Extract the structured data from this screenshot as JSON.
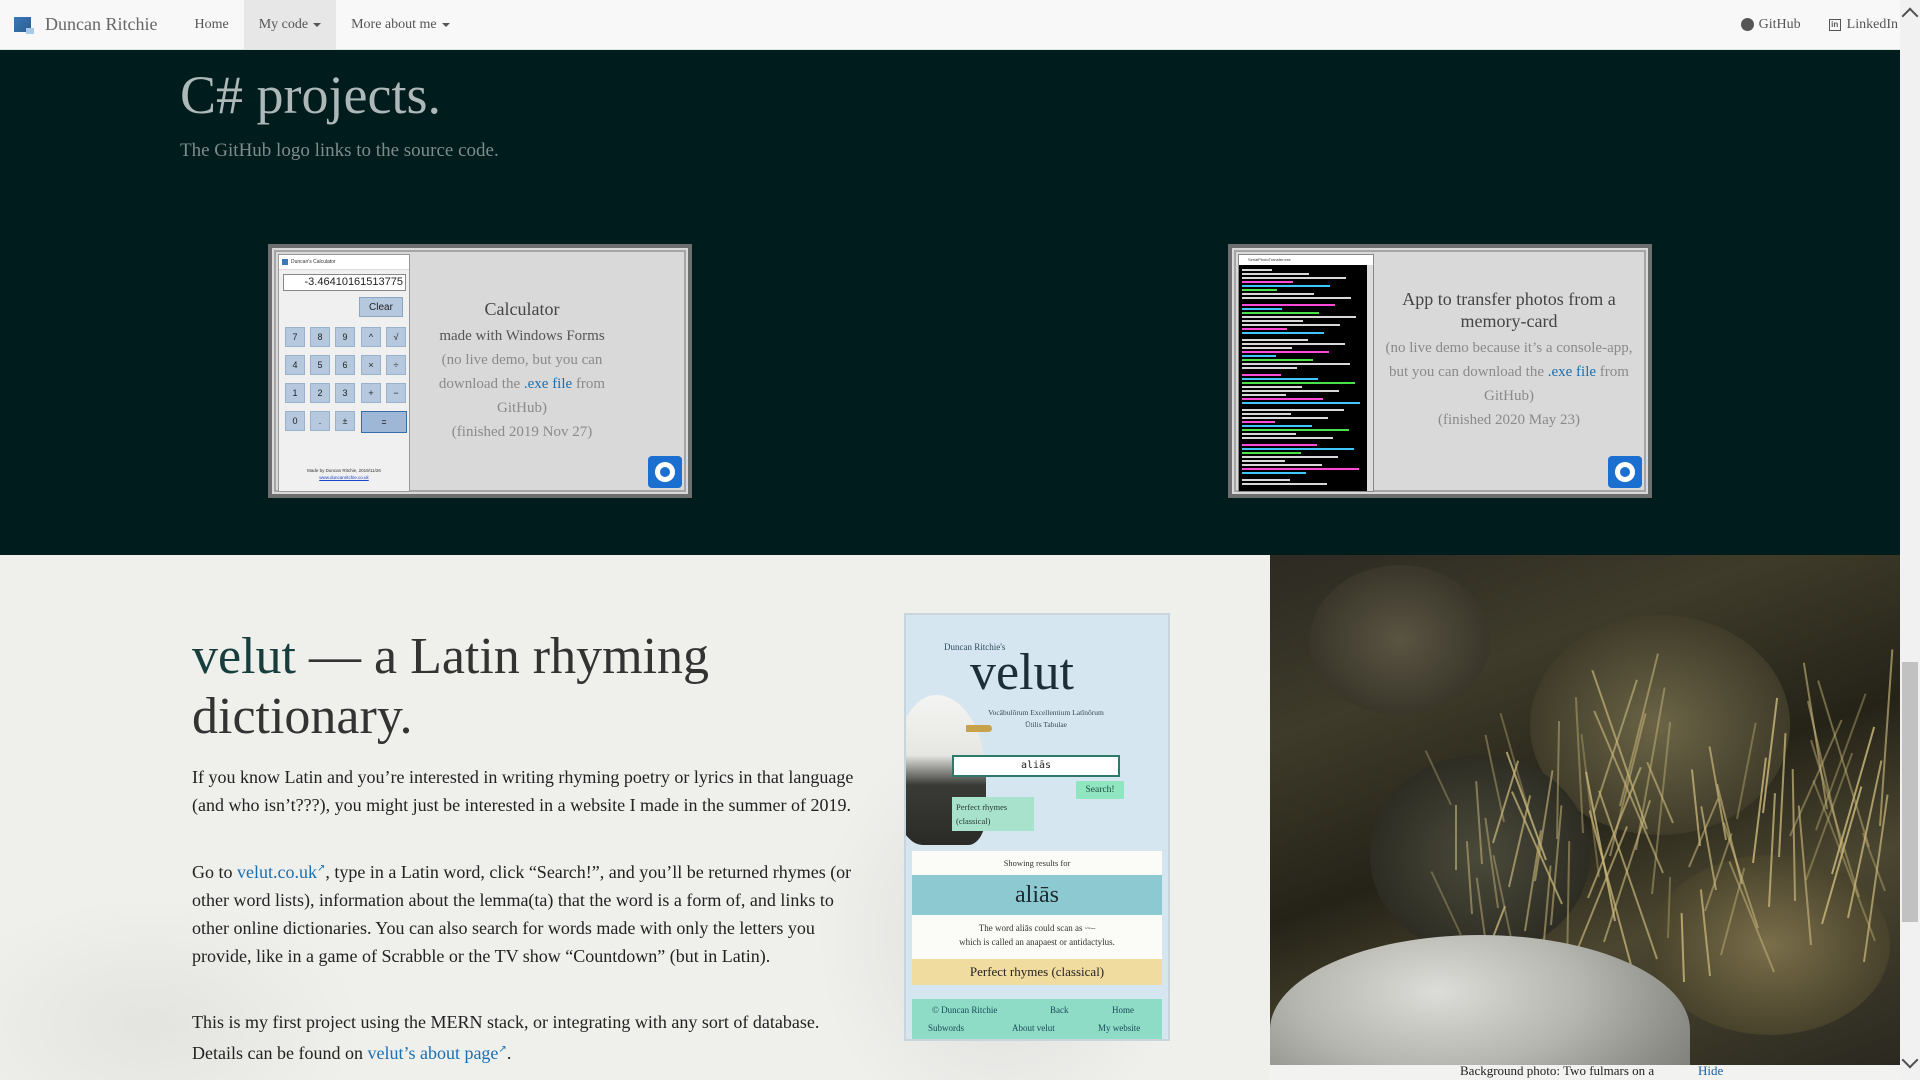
{
  "navbar": {
    "brand": "Duncan Ritchie",
    "items": [
      {
        "label": "Home"
      },
      {
        "label": "My code",
        "dropdown": true,
        "active": true
      },
      {
        "label": "More about me",
        "dropdown": true
      }
    ],
    "right": [
      {
        "label": "GitHub",
        "icon": "github-icon"
      },
      {
        "label": "LinkedIn",
        "icon": "linkedin-icon"
      }
    ]
  },
  "csharp": {
    "title": "C# projects.",
    "subtitle": "The GitHub logo links to the source code.",
    "projects": [
      {
        "title": "Calculator",
        "line1": "made with Windows Forms",
        "line2a": "(no live demo, but you can download the ",
        "link": ".exe file",
        "line2b": " from GitHub)",
        "finished": "(finished 2019 Nov 27)",
        "screenshot": {
          "window_title": "Duncan's Calculator",
          "display": "-3.46410161513775",
          "clear": "Clear",
          "keys": [
            "7",
            "8",
            "9",
            "^",
            "√",
            "4",
            "5",
            "6",
            "×",
            "÷",
            "1",
            "2",
            "3",
            "+",
            "−",
            "0",
            ".",
            "±"
          ],
          "equals": "=",
          "footer": "Made by Duncan Ritchie, 2019/11/26",
          "footer_link": "www.duncanritchie.co.uk"
        }
      },
      {
        "title": "App to transfer photos from a memory-card",
        "line2a": "(no live demo because it’s a console-app, but you can download the ",
        "link": ".exe file",
        "line2b": " from GitHub)",
        "finished": "(finished 2020 May 23)",
        "screenshot": {
          "window_title": "SerialPhotoTransfer.exe"
        }
      }
    ]
  },
  "velut": {
    "title_accent": "velut",
    "title_rest": " — a Latin rhyming dictionary.",
    "p1": "If you know Latin and you’re interested in writing rhyming poetry or lyrics in that language (and who isn’t???), you might just be interested in a website I made in the summer of 2019.",
    "p2_pre": "Go to ",
    "p2_link": "velut.co.uk",
    "p2_post": ", type in a Latin word, click “Search!”, and you’ll be returned rhymes (or other word lists), information about the lemma(ta) that the word is a form of, and links to other online dictionaries. You can also search for words made with only the letters you provide, like in a game of Scrabble or the TV show “Countdown” (but in Latin).",
    "p3_pre": "This is my first project using the MERN stack, or integrating with any sort of database. Details can be found on ",
    "p3_link": "velut’s about page",
    "p3_post": ".",
    "phone": {
      "byline": "Duncan Ritchie's",
      "logo": "velut",
      "motto": "Vocābulōrum Excellentium Latīnōrum Ūtilis Tabulae",
      "input": "aliās",
      "search": "Search!",
      "mode": "Perfect rhymes (classical)",
      "showing": "Showing results for",
      "word": "aliās",
      "scan1": "The word aliās could scan as ⏑⏑–",
      "scan2": "which is called an anapaest or antidactylus.",
      "perfect": "Perfect rhymes (classical)",
      "footer": {
        "copyright": "© Duncan Ritchie",
        "back": "Back",
        "home": "Home",
        "subwords": "Subwords",
        "about": "About velut",
        "website": "My website"
      }
    },
    "caption": "Background photo: Two fulmars on a",
    "hide": "Hide"
  }
}
